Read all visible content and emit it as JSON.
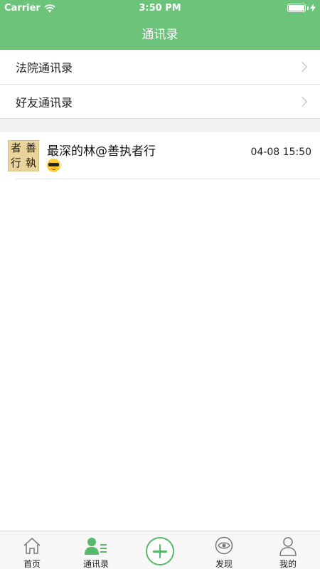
{
  "status_bar": {
    "carrier": "Carrier",
    "time": "3:50 PM",
    "battery_level": 1.0
  },
  "nav": {
    "title": "通讯录"
  },
  "menu": {
    "items": [
      {
        "label": "法院通讯录"
      },
      {
        "label": "好友通讯录"
      }
    ]
  },
  "contacts": [
    {
      "avatar_text": [
        "者",
        "善",
        "行",
        "執"
      ],
      "name": "最深的林@善执者行",
      "emoji": "sunglasses-emoji",
      "time": "04-08 15:50"
    }
  ],
  "tabbar": {
    "items": [
      {
        "label": "首页",
        "icon": "home-icon"
      },
      {
        "label": "通讯录",
        "icon": "contacts-icon",
        "active": true,
        "color": "#58b96a"
      },
      {
        "label": "",
        "icon": "plus-circle-icon"
      },
      {
        "label": "发现",
        "icon": "eye-icon"
      },
      {
        "label": "我的",
        "icon": "person-icon"
      }
    ]
  },
  "colors": {
    "header": "#6cc47a",
    "accent": "#58b96a"
  }
}
